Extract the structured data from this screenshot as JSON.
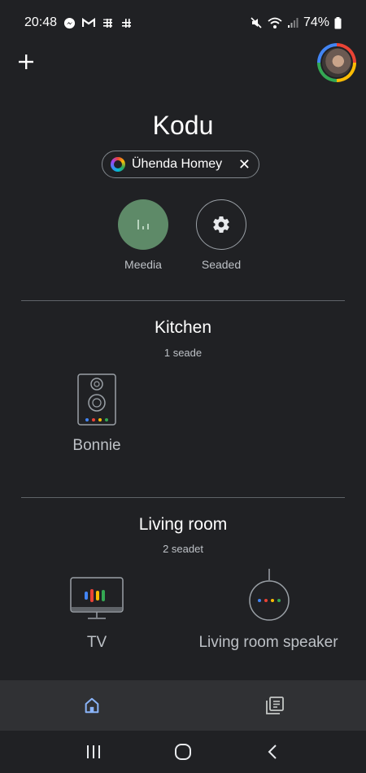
{
  "status_bar": {
    "time": "20:48",
    "battery": "74%",
    "icons_left": [
      "messenger-icon",
      "gmail-icon",
      "grid-icon",
      "grid-icon"
    ],
    "icons_right": [
      "mute-icon",
      "wifi-icon",
      "signal-icon",
      "battery-icon"
    ]
  },
  "header": {
    "add_icon": "+",
    "title": "Kodu"
  },
  "chip": {
    "label": "Ühenda Homey",
    "close": "✕"
  },
  "quick_actions": [
    {
      "label": "Meedia",
      "icon": "media-bars-icon",
      "color": "#5e8a68"
    },
    {
      "label": "Seaded",
      "icon": "gear-icon"
    }
  ],
  "rooms": [
    {
      "name": "Kitchen",
      "count": "1 seade",
      "devices": [
        {
          "label": "Bonnie",
          "icon": "speaker-icon"
        }
      ]
    },
    {
      "name": "Living room",
      "count": "2 seadet",
      "devices": [
        {
          "label": "TV",
          "icon": "tv-icon"
        },
        {
          "label": "Living room speaker",
          "icon": "smart-speaker-icon"
        }
      ]
    }
  ],
  "bottom_nav": [
    {
      "name": "home",
      "icon": "home-icon",
      "active": true,
      "color": "#8ab4f8"
    },
    {
      "name": "feed",
      "icon": "feed-icon",
      "active": false
    }
  ],
  "system_nav": [
    "recents-icon",
    "home-circle-icon",
    "back-icon"
  ],
  "colors": {
    "google_red": "#ea4335",
    "google_yellow": "#fbbc04",
    "google_green": "#34a853",
    "google_blue": "#4285f4"
  }
}
